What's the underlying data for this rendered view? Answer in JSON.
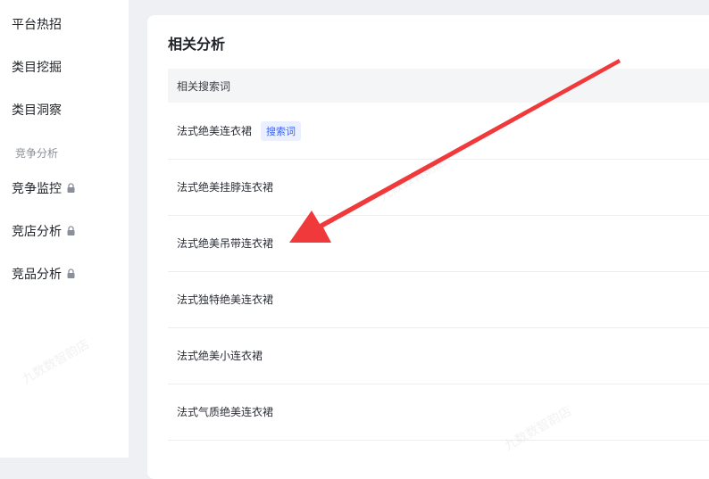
{
  "sidebar": {
    "items": [
      {
        "label": "平台热招",
        "locked": false
      },
      {
        "label": "类目挖掘",
        "locked": false
      },
      {
        "label": "类目洞察",
        "locked": false
      }
    ],
    "group_label": "竞争分析",
    "group_items": [
      {
        "label": "竞争监控",
        "locked": true
      },
      {
        "label": "竞店分析",
        "locked": true
      },
      {
        "label": "竞品分析",
        "locked": true
      }
    ]
  },
  "card": {
    "title": "相关分析",
    "column_header": "相关搜索词",
    "rows": [
      {
        "keyword": "法式绝美连衣裙",
        "tag": "搜索词"
      },
      {
        "keyword": "法式绝美挂脖连衣裙"
      },
      {
        "keyword": "法式绝美吊带连衣裙"
      },
      {
        "keyword": "法式独特绝美连衣裙"
      },
      {
        "keyword": "法式绝美小连衣裙"
      },
      {
        "keyword": "法式气质绝美连衣裙"
      }
    ]
  },
  "watermark_text": "九数数智韵店",
  "colors": {
    "accent": "#3a63f5",
    "arrow": "#f0393b",
    "page_bg": "#eef0f4"
  }
}
